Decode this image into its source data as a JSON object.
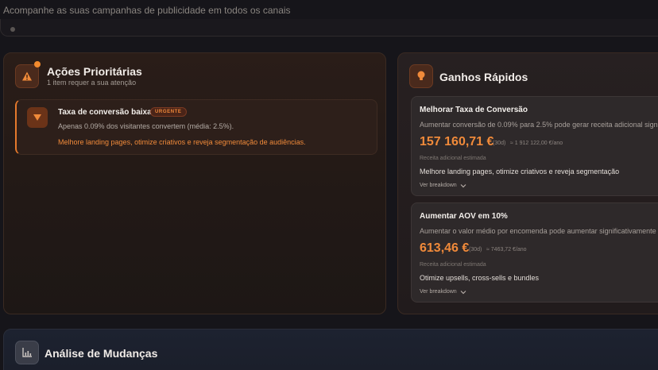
{
  "header": {
    "subtitle": "Acompanhe as suas campanhas de publicidade em todos os canais"
  },
  "priority_actions": {
    "title": "Ações Prioritárias",
    "subtitle": "1 item requer a sua atenção",
    "icon": "warning-icon",
    "alerts": [
      {
        "title": "Taxa de conversão baixa",
        "badge": "URGENTE",
        "description": "Apenas 0.09% dos visitantes convertem (média: 2.5%).",
        "recommendation": "Melhore landing pages, otimize criativos e reveja segmentação de audiências.",
        "icon": "funnel-icon"
      }
    ]
  },
  "quick_wins": {
    "title": "Ganhos Rápidos",
    "icon": "lightbulb-icon",
    "cards": [
      {
        "title": "Melhorar Taxa de Conversão",
        "description": "Aumentar conversão de 0.09% para 2.5% pode gerar receita adicional significativa",
        "value": "157 160,71 €",
        "period": "(30d)",
        "yearly": "≈ 1 912 122,00 €/ano",
        "label": "Receita adicional estimada",
        "action": "Melhore landing pages, otimize criativos e reveja segmentação",
        "breakdown": "Ver breakdown"
      },
      {
        "title": "Aumentar AOV em 10%",
        "description": "Aumentar o valor médio por encomenda pode aumentar significativamente a receita",
        "value": "613,46 €",
        "period": "(30d)",
        "yearly": "≈ 7463,72 €/ano",
        "label": "Receita adicional estimada",
        "action": "Otimize upsells, cross-sells e bundles",
        "breakdown": "Ver breakdown"
      }
    ]
  },
  "change_analysis": {
    "title": "Análise de Mudanças",
    "icon": "bar-chart-icon"
  },
  "colors": {
    "accent": "#f08a3a",
    "background": "#16151a"
  }
}
